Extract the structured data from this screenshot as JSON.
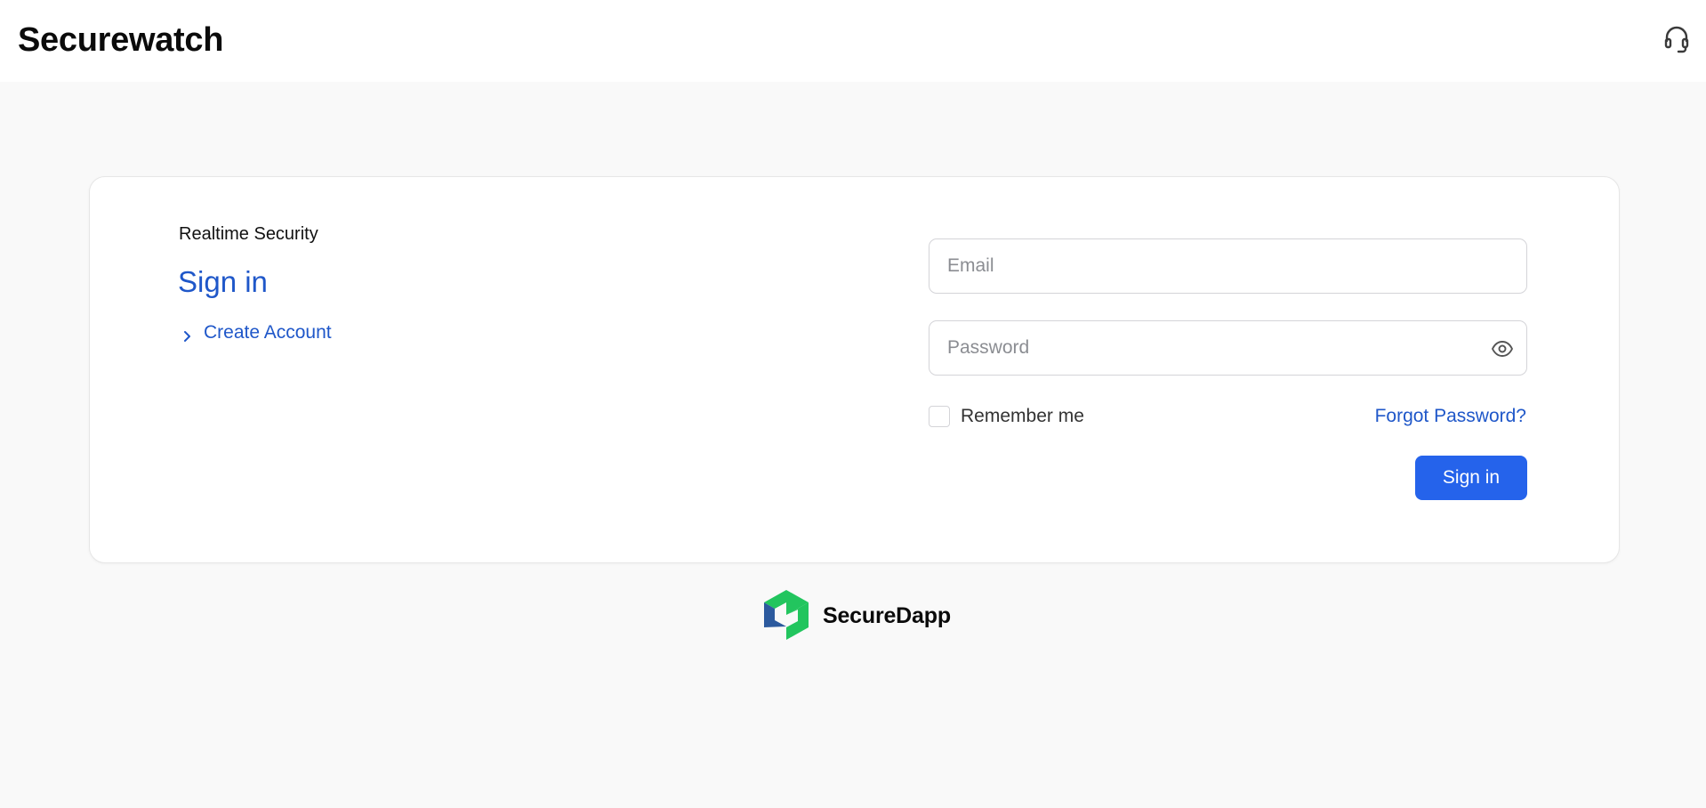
{
  "header": {
    "brand": "Securewatch",
    "support_icon": "headset-icon"
  },
  "login": {
    "eyebrow": "Realtime Security",
    "title": "Sign in",
    "create_account_label": "Create Account",
    "create_account_icon": "chevron-right-icon",
    "email_placeholder": "Email",
    "email_value": "",
    "password_placeholder": "Password",
    "password_value": "",
    "password_toggle_icon": "eye-icon",
    "remember_label": "Remember me",
    "remember_checked": false,
    "forgot_label": "Forgot Password?",
    "submit_label": "Sign in"
  },
  "footer": {
    "logo_text": "SecureDapp",
    "logo_icon": "securedapp-logo-icon"
  },
  "colors": {
    "accent": "#1f57c9",
    "button": "#2563eb",
    "logo_green": "#22c55e",
    "logo_blue": "#2c5a9e",
    "page_bg": "#f9f9f9"
  }
}
